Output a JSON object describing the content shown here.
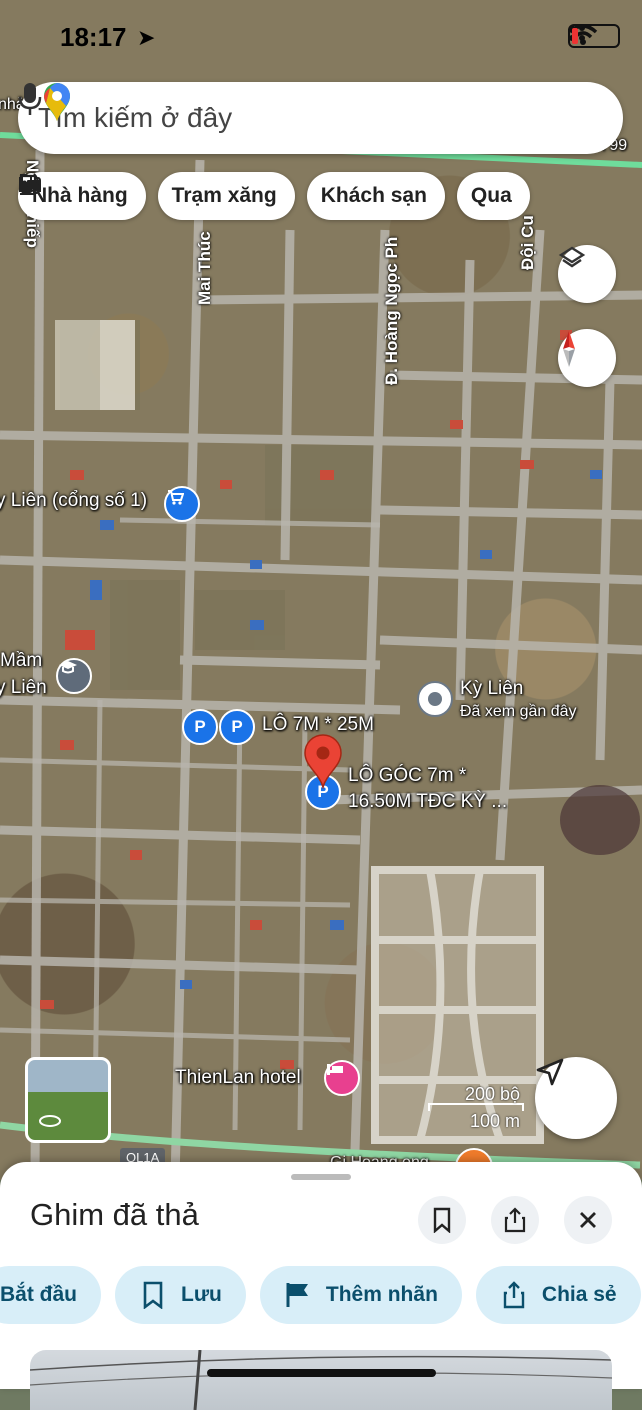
{
  "status_bar": {
    "time": "18:17"
  },
  "search": {
    "placeholder": "Tìm kiếm ở đây"
  },
  "chips": [
    {
      "label": "Nhà hàng",
      "icon": "restaurant-icon"
    },
    {
      "label": "Trạm xăng",
      "icon": "gas-station-icon"
    },
    {
      "label": "Khách sạn",
      "icon": "hotel-icon"
    },
    {
      "label": "Qua",
      "icon": "coffee-icon"
    }
  ],
  "map": {
    "streets": {
      "nguyen_thiep": "Ng    n Thiếp",
      "mai_thuc": "Mai Thúc",
      "hoang_ngoc_phach": "Đ. Hoàng Ngọc Ph",
      "doi_cung": "Đội Cu",
      "top_left": "nhả",
      "top_right": "n 99",
      "highway": "QL1A"
    },
    "places": {
      "ky_lien_gate": "y Liên (cổng số 1)",
      "mam_line1": "Mầm",
      "mam_line2": "y Liên",
      "ky_lien": "Kỳ Liên",
      "ky_lien_sub": "Đã xem gần đây",
      "lot_7m": "LÔ 7M * 25M",
      "lot_corner_1": "LÔ GÓC 7m *",
      "lot_corner_2": "16.50M TĐC KỲ ...",
      "hotel": "ThienLan hotel",
      "bottom_cut": "Gi  Hoang  ong"
    },
    "scale": {
      "top": "200 bộ",
      "bottom": "100 m"
    }
  },
  "sheet": {
    "title": "Ghim đã thả",
    "actions": [
      {
        "label": "Bắt đầu",
        "icon": "directions-icon"
      },
      {
        "label": "Lưu",
        "icon": "bookmark-icon"
      },
      {
        "label": "Thêm nhãn",
        "icon": "flag-icon"
      },
      {
        "label": "Chia sẻ",
        "icon": "share-icon"
      }
    ]
  },
  "colors": {
    "accent": "#1a73e8",
    "pin_red": "#ea4335",
    "action_bg": "#d8eef8",
    "action_text": "#0b4f6c",
    "hotel_pink": "#e8408f",
    "poi_blue": "#1a73e8"
  }
}
